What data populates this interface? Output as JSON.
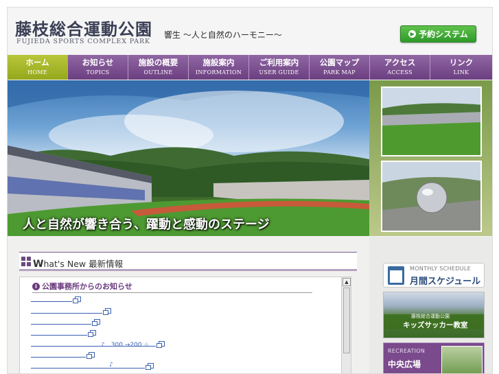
{
  "header": {
    "title_ja": "藤枝総合運動公園",
    "title_en": "FUJIEDA SPORTS COMPLEX PARK",
    "tagline": "響生 ～人と自然のハーモニー～",
    "reserve_label": "予約システム"
  },
  "nav": [
    {
      "ja": "ホーム",
      "en": "HOME"
    },
    {
      "ja": "お知らせ",
      "en": "TOPICS"
    },
    {
      "ja": "施設の概要",
      "en": "OUTLINE"
    },
    {
      "ja": "施設案内",
      "en": "INFORMATION"
    },
    {
      "ja": "ご利用案内",
      "en": "USER GUIDE"
    },
    {
      "ja": "公園マップ",
      "en": "PARK MAP"
    },
    {
      "ja": "アクセス",
      "en": "ACCESS"
    },
    {
      "ja": "リンク",
      "en": "LINK"
    }
  ],
  "hero": {
    "caption": "人と自然が響き合う、躍動と感動のステージ"
  },
  "news": {
    "title_en_first": "W",
    "title_en_rest": "hat's New",
    "title_ja": "最新情報",
    "section_label": "公園事務所からのお知らせ",
    "extra_text_1": "♪　300 →200 ☆",
    "extra_text_2": "♪"
  },
  "sidebar": {
    "schedule_en": "MONTHLY SCHEDULE",
    "schedule_ja": "月間スケジュール",
    "kids_small": "藤枝総合運動公園",
    "kids_big": "キッズサッカー教室",
    "recreation_en": "RECREATION",
    "recreation_ja": "中央広場"
  },
  "colors": {
    "nav_purple": "#7a4a8c",
    "nav_active": "#a8b82a",
    "reserve_green": "#3aa431",
    "link_blue": "#3a5fb0"
  }
}
